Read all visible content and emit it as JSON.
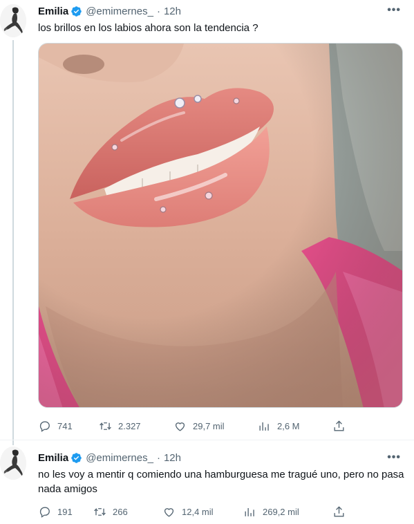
{
  "tweets": [
    {
      "name": "Emilia",
      "handle": "@emimernes_",
      "separator": "·",
      "time": "12h",
      "text": "los brillos en los labios ahora son la tendencia ?",
      "stats": {
        "replies": "741",
        "retweets": "2.327",
        "likes": "29,7 mil",
        "views": "2,6 M"
      }
    },
    {
      "name": "Emilia",
      "handle": "@emimernes_",
      "separator": "·",
      "time": "12h",
      "text": "no les voy a mentir q comiendo una hamburguesa me tragué uno, pero no pasa nada amigos",
      "stats": {
        "replies": "191",
        "retweets": "266",
        "likes": "12,4 mil",
        "views": "269,2 mil"
      }
    }
  ],
  "colors": {
    "verified": "#1d9bf0",
    "text": "#0f1419",
    "secondary": "#536471",
    "border": "#cfd9de"
  },
  "icons": [
    "verified-icon",
    "more-icon",
    "reply-icon",
    "retweet-icon",
    "like-icon",
    "views-icon",
    "share-icon"
  ]
}
